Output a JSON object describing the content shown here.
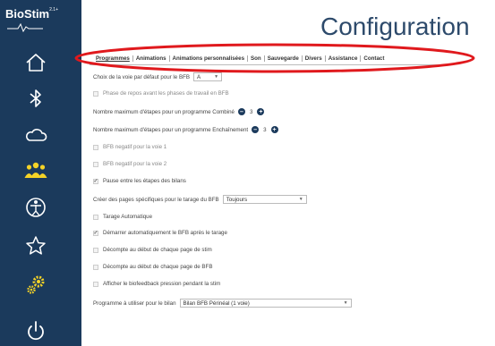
{
  "app": {
    "name": "BioStim",
    "version_sup": "2.1+",
    "page_title": "Configuration"
  },
  "colors": {
    "sidebar_bg": "#1b3a5c",
    "icon_color": "#ffffff",
    "highlight": "#e0191d",
    "title": "#2d4a6b"
  },
  "sidebar": {
    "items": [
      {
        "name": "home",
        "icon": "home-icon"
      },
      {
        "name": "bluetooth",
        "icon": "bluetooth-icon"
      },
      {
        "name": "cloud",
        "icon": "cloud-icon"
      },
      {
        "name": "patients",
        "icon": "users-icon"
      },
      {
        "name": "anatomy",
        "icon": "anatomy-icon"
      },
      {
        "name": "favorites",
        "icon": "star-icon"
      },
      {
        "name": "settings",
        "icon": "gears-icon"
      },
      {
        "name": "power",
        "icon": "power-icon"
      }
    ]
  },
  "tabs": [
    {
      "label": "Programmes",
      "active": true
    },
    {
      "label": "Animations",
      "active": false
    },
    {
      "label": "Animations personnalisées",
      "active": false
    },
    {
      "label": "Son",
      "active": false
    },
    {
      "label": "Sauvegarde",
      "active": false
    },
    {
      "label": "Divers",
      "active": false
    },
    {
      "label": "Assistance",
      "active": false
    },
    {
      "label": "Contact",
      "active": false
    }
  ],
  "settings": {
    "voie_bfb_label": "Choix de la voie par défaut pour le BFB",
    "voie_bfb_value": "A",
    "repos_label": "Phase de repos avant les phases de travail en BFB",
    "combine_label": "Nombre maximum d'étapes pour un programme Combiné",
    "combine_value": "3",
    "enchainement_label": "Nombre maximum d'étapes pour un programme Enchaînement",
    "enchainement_value": "3",
    "bfb_neg1_label": "BFB negatif pour la voie 1",
    "bfb_neg2_label": "BFB negatif pour la voie 2",
    "pause_label": "Pause entre les étapes des bilans",
    "pages_label": "Créer des pages spécifiques pour le tarage du BFB",
    "pages_value": "Toujours",
    "tarage_auto_label": "Tarage Automatique",
    "demarrer_label": "Démarrer automatiquement le BFB après le tarage",
    "decompte_stim_label": "Décompte au début de chaque page de stim",
    "decompte_bfb_label": "Décompte au début de chaque page de BFB",
    "biofeedback_label": "Afficher le biofeedback pression pendant la stim",
    "programme_bilan_label": "Programme à utiliser pour le bilan",
    "programme_bilan_value": "Bilan BFB Périnéal (1 voie)"
  },
  "checkbox_states": {
    "repos": false,
    "bfb_neg1": false,
    "bfb_neg2": false,
    "pause": true,
    "tarage_auto": false,
    "demarrer": true,
    "decompte_stim": false,
    "decompte_bfb": false,
    "biofeedback": false
  }
}
